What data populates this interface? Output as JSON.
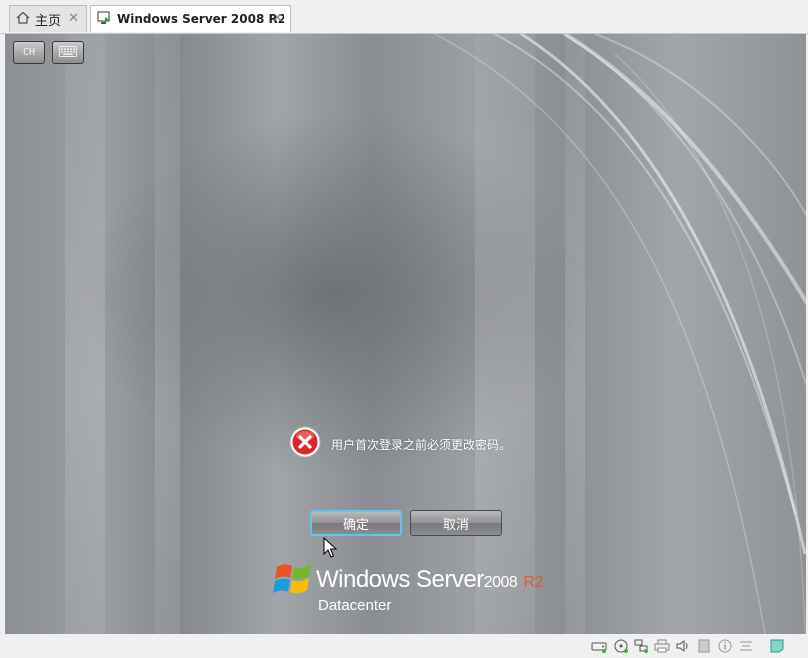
{
  "tabs": [
    {
      "label": "主页",
      "icon": "home-icon",
      "active": false
    },
    {
      "label": "Windows Server 2008 R2 ...",
      "icon": "vm-icon",
      "active": true
    }
  ],
  "vm_toolbar": {
    "lang_label": "CH",
    "keyboard_icon": "keyboard-icon"
  },
  "dialog": {
    "message": "用户首次登录之前必须更改密码。",
    "ok_label": "确定",
    "cancel_label": "取消",
    "icon": "error-icon"
  },
  "branding": {
    "windows": "Windows",
    "server": "Server",
    "version": "2008",
    "r2": "R2",
    "edition": "Datacenter"
  },
  "colors": {
    "r2_accent": "#e05a3a",
    "focus_border": "#5ec7e8",
    "error_red": "#d8262c"
  },
  "statusbar_icons": [
    "hard-disk-icon",
    "cd-dvd-icon",
    "network-icon",
    "printer-icon",
    "sound-icon",
    "usb-icon",
    "info-icon",
    "display-icon",
    "message-icon"
  ]
}
